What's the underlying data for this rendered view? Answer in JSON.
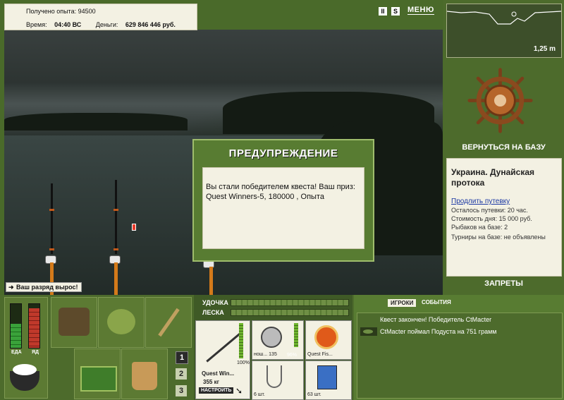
{
  "hud": {
    "experience_label": "Получено опыта:",
    "experience_value": "94500",
    "time_label": "Время:",
    "time_value": "04:40 ВС",
    "money_label": "Деньги:",
    "money_value": "629 846 446 руб."
  },
  "top_controls": {
    "pause_glyph": "II",
    "sound_glyph": "S",
    "menu_label": "МЕНЮ"
  },
  "depth": {
    "value": "1,25 m"
  },
  "base": {
    "return_label": "ВЕРНУТЬСЯ НА БАЗУ",
    "location_title": "Украина. Дунайская протока",
    "extend_link": "Продлить путевку",
    "info": [
      "Осталось путевки: 20 час.",
      "Стоимость дня: 15 000 руб.",
      "Рыбаков на базе: 2",
      "Турниры на базе: не объявлены"
    ],
    "bans_label": "ЗАПРЕТЫ"
  },
  "dialog": {
    "title": "ПРЕДУПРЕЖДЕНИЕ",
    "message": "Вы стали победителем квеста! Ваш приз: Quest Winners-5, 180000 , Опыта"
  },
  "rank_notice": "Ваш разряд вырос!",
  "needs": {
    "food_label": "ЕДА",
    "poison_label": "ЯД",
    "food_level": 0.55,
    "poison_level": 0.9
  },
  "rod_slots": [
    "1",
    "2",
    "3"
  ],
  "tackle": {
    "rod_label": "УДОЧКА",
    "line_label": "ЛЕСКА",
    "rod_name": "Quest Win...",
    "rod_weight": "355 кг",
    "rod_condition": "100%",
    "setup_button": "НАСТРОИТЬ",
    "reel_name": "нош... 135",
    "reel_condition": "96%",
    "line_name": "Quest Fis...",
    "hook_count": "6 шт.",
    "bait_count": "63 шт."
  },
  "events": {
    "tab_players": "ИГРОКИ",
    "tab_events": "СОБЫТИЯ",
    "lines": [
      "Квест закончен! Победитель CtMacter",
      "CtMacter поймал Подуста на 751 грамм"
    ]
  },
  "colors": {
    "panel_green": "#4d6b2c",
    "dialog_green": "#587c32",
    "cream": "#f3f1e3",
    "accent_orange": "#d47a1a",
    "meter_green": "#3aa23a",
    "meter_red": "#c0392b"
  }
}
